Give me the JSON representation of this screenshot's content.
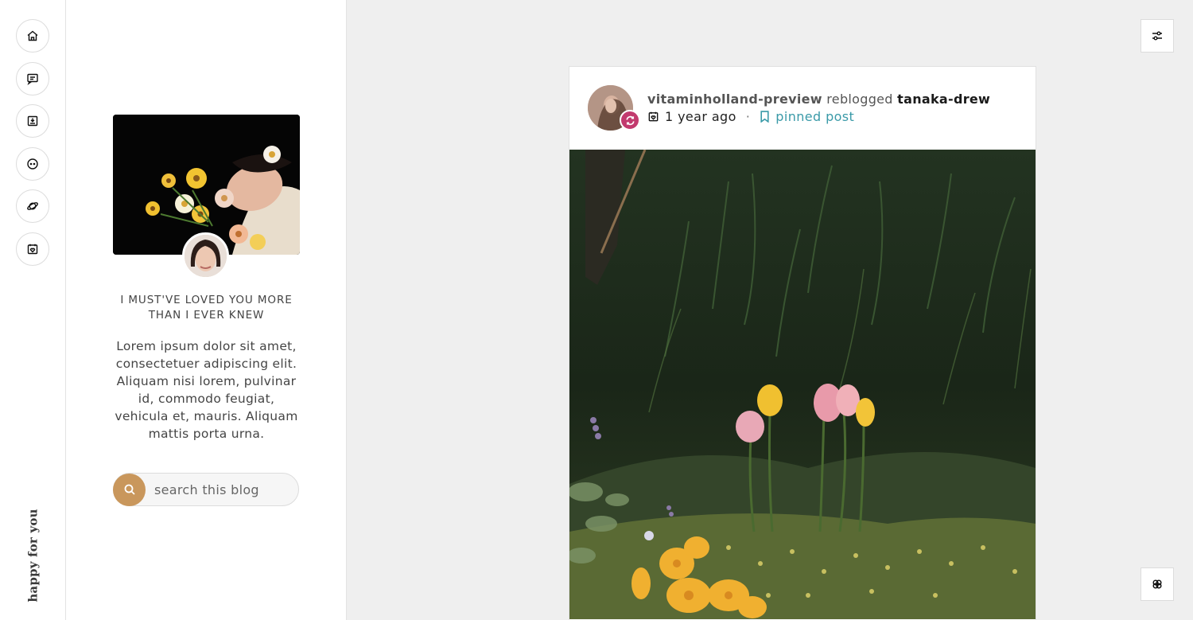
{
  "rail": {
    "items": [
      {
        "name": "home-icon"
      },
      {
        "name": "message-icon"
      },
      {
        "name": "inbox-icon"
      },
      {
        "name": "face-icon"
      },
      {
        "name": "planet-icon"
      },
      {
        "name": "calendar-heart-icon"
      }
    ],
    "vertical_title": "happy for you"
  },
  "sidebar": {
    "title": "I MUST'VE LOVED YOU MORE THAN I EVER KNEW",
    "description": "Lorem ipsum dolor sit amet, consectetuer adipiscing elit. Aliquam nisi lorem, pulvinar id, commodo feugiat, vehicula et, mauris. Aliquam mattis porta urna.",
    "search": {
      "placeholder": "search this blog"
    }
  },
  "post": {
    "reblogger": "vitaminholland-preview",
    "action": "reblogged",
    "original_author": "tanaka-drew",
    "timestamp": "1 year ago",
    "separator": "·",
    "pinned_label": "pinned post"
  },
  "colors": {
    "accent": "#c9975c",
    "reblog": "#c23a6e",
    "pinned": "#3a9aa8"
  }
}
